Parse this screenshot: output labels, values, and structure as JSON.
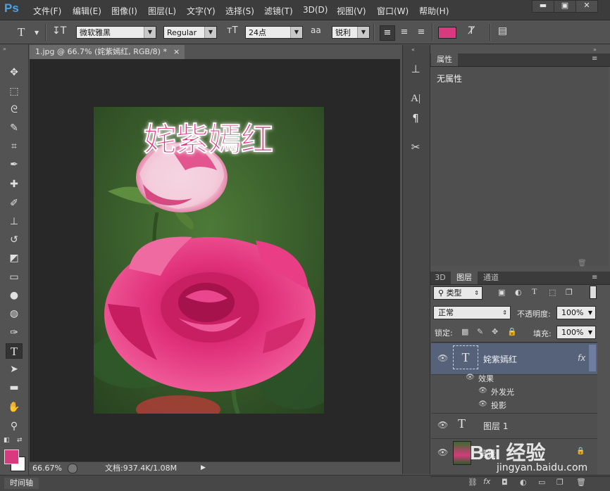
{
  "app": {
    "logo": "Ps",
    "menu": [
      "文件(F)",
      "编辑(E)",
      "图像(I)",
      "图层(L)",
      "文字(Y)",
      "选择(S)",
      "滤镜(T)",
      "3D(D)",
      "视图(V)",
      "窗口(W)",
      "帮助(H)"
    ],
    "window_controls": [
      "minimize-icon",
      "restore-icon",
      "close-icon"
    ]
  },
  "options": {
    "tool_icon": "T",
    "font_family": "微软雅黑",
    "font_style": "Regular",
    "font_size": "24点",
    "aa_label": "aa",
    "antialias": "锐利",
    "text_color": "#d93a7d"
  },
  "document": {
    "tab_title": "1.jpg @ 66.7% (姹紫嫣红, RGB/8) *",
    "tab_close": "×",
    "image_text": "姹紫嫣红",
    "zoom": "66.67%",
    "doc_size": "文档:937.4K/1.08M"
  },
  "timeline": {
    "label": "时间轴"
  },
  "properties": {
    "tab": "属性",
    "body": "无属性"
  },
  "layers": {
    "tabs": [
      "3D",
      "图层",
      "通道"
    ],
    "filter_label": "类型",
    "blend_mode": "正常",
    "opacity_label": "不透明度:",
    "opacity_value": "100%",
    "lock_label": "锁定:",
    "fill_label": "填充:",
    "fill_value": "100%",
    "items": [
      {
        "name": "姹紫嫣红",
        "type": "text",
        "fx": "fx"
      },
      {
        "name": "效果"
      },
      {
        "name": "外发光"
      },
      {
        "name": "投影"
      },
      {
        "name": "图层 1",
        "type": "text"
      },
      {
        "name": "背景",
        "type": "image"
      }
    ]
  },
  "watermark": {
    "brand": "Bai 经验",
    "url": "jingyan.baidu.com"
  },
  "colors": {
    "foreground": "#d93a7d",
    "background": "#ffffff",
    "accent": "#4aa3df",
    "selected_layer": "#55627a"
  }
}
